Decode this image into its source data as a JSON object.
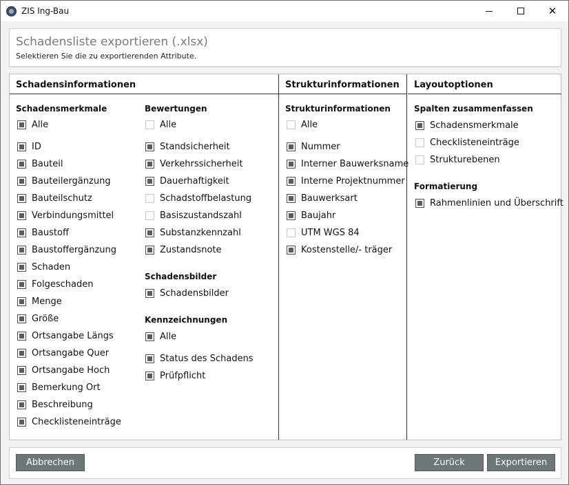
{
  "window": {
    "title": "ZIS Ing-Bau"
  },
  "header": {
    "title": "Schadensliste exportieren (.xlsx)",
    "subtitle": "Selektieren Sie die zu exportierenden Attribute."
  },
  "columns": {
    "schadensinformationen": "Schadensinformationen",
    "strukturinformationen": "Strukturinformationen",
    "layoutoptionen": "Layoutoptionen"
  },
  "schadensmerkmale": {
    "label": "Schadensmerkmale",
    "items": [
      {
        "label": "Alle",
        "checked": true
      },
      {
        "label": "ID",
        "checked": true
      },
      {
        "label": "Bauteil",
        "checked": true
      },
      {
        "label": "Bauteilergänzung",
        "checked": true
      },
      {
        "label": "Bauteilschutz",
        "checked": true
      },
      {
        "label": "Verbindungsmittel",
        "checked": true
      },
      {
        "label": "Baustoff",
        "checked": true
      },
      {
        "label": "Baustoffergänzung",
        "checked": true
      },
      {
        "label": "Schaden",
        "checked": true
      },
      {
        "label": "Folgeschaden",
        "checked": true
      },
      {
        "label": "Menge",
        "checked": true
      },
      {
        "label": "Größe",
        "checked": true
      },
      {
        "label": "Ortsangabe Längs",
        "checked": true
      },
      {
        "label": "Ortsangabe Quer",
        "checked": true
      },
      {
        "label": "Ortsangabe Hoch",
        "checked": true
      },
      {
        "label": "Bemerkung Ort",
        "checked": true
      },
      {
        "label": "Beschreibung",
        "checked": true
      },
      {
        "label": "Checklisteneinträge",
        "checked": true
      }
    ]
  },
  "bewertungen": {
    "label": "Bewertungen",
    "items": [
      {
        "label": "Alle",
        "checked": false
      },
      {
        "label": "Standsicherheit",
        "checked": true
      },
      {
        "label": "Verkehrssicherheit",
        "checked": true
      },
      {
        "label": "Dauerhaftigkeit",
        "checked": true
      },
      {
        "label": "Schadstoffbelastung",
        "checked": false
      },
      {
        "label": "Basiszustandszahl",
        "checked": false
      },
      {
        "label": "Substanzkennzahl",
        "checked": true
      },
      {
        "label": "Zustandsnote",
        "checked": true
      }
    ]
  },
  "schadensbilder": {
    "label": "Schadensbilder",
    "items": [
      {
        "label": "Schadensbilder",
        "checked": true
      }
    ]
  },
  "kennzeichnungen": {
    "label": "Kennzeichnungen",
    "items": [
      {
        "label": "Alle",
        "checked": true
      },
      {
        "label": "Status des Schadens",
        "checked": true
      },
      {
        "label": "Prüfpflicht",
        "checked": true
      }
    ]
  },
  "struktur": {
    "label": "Strukturinformationen",
    "items": [
      {
        "label": "Alle",
        "checked": false
      },
      {
        "label": "Nummer",
        "checked": true
      },
      {
        "label": "Interner Bauwerksname",
        "checked": true
      },
      {
        "label": "Interne Projektnummer",
        "checked": true
      },
      {
        "label": "Bauwerksart",
        "checked": true
      },
      {
        "label": "Baujahr",
        "checked": true
      },
      {
        "label": "UTM WGS 84",
        "checked": false
      },
      {
        "label": "Kostenstelle/- träger",
        "checked": true
      }
    ]
  },
  "spalten": {
    "label": "Spalten zusammenfassen",
    "items": [
      {
        "label": "Schadensmerkmale",
        "checked": true
      },
      {
        "label": "Checklisteneinträge",
        "checked": false
      },
      {
        "label": "Strukturebenen",
        "checked": false
      }
    ]
  },
  "formatierung": {
    "label": "Formatierung",
    "items": [
      {
        "label": "Rahmenlinien und Überschrift",
        "checked": true
      }
    ]
  },
  "footer": {
    "cancel": "Abbrechen",
    "back": "Zurück",
    "export": "Exportieren"
  }
}
